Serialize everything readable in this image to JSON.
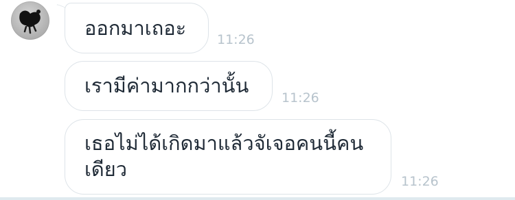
{
  "chat": {
    "messages": [
      {
        "text": "ออกมาเถอะ",
        "time": "11:26"
      },
      {
        "text": "เรามีค่ามากกว่านั้น",
        "time": "11:26"
      },
      {
        "text": "เธอไม่ได้เกิดมาแล้วจัเจอคนนี้คน\nเดียว",
        "time": "11:26"
      }
    ]
  },
  "colors": {
    "bubble_border": "#dde3e8",
    "text": "#1f2a36",
    "timestamp": "#b7c3cc"
  },
  "icons": {
    "avatar": "contact-photo"
  }
}
